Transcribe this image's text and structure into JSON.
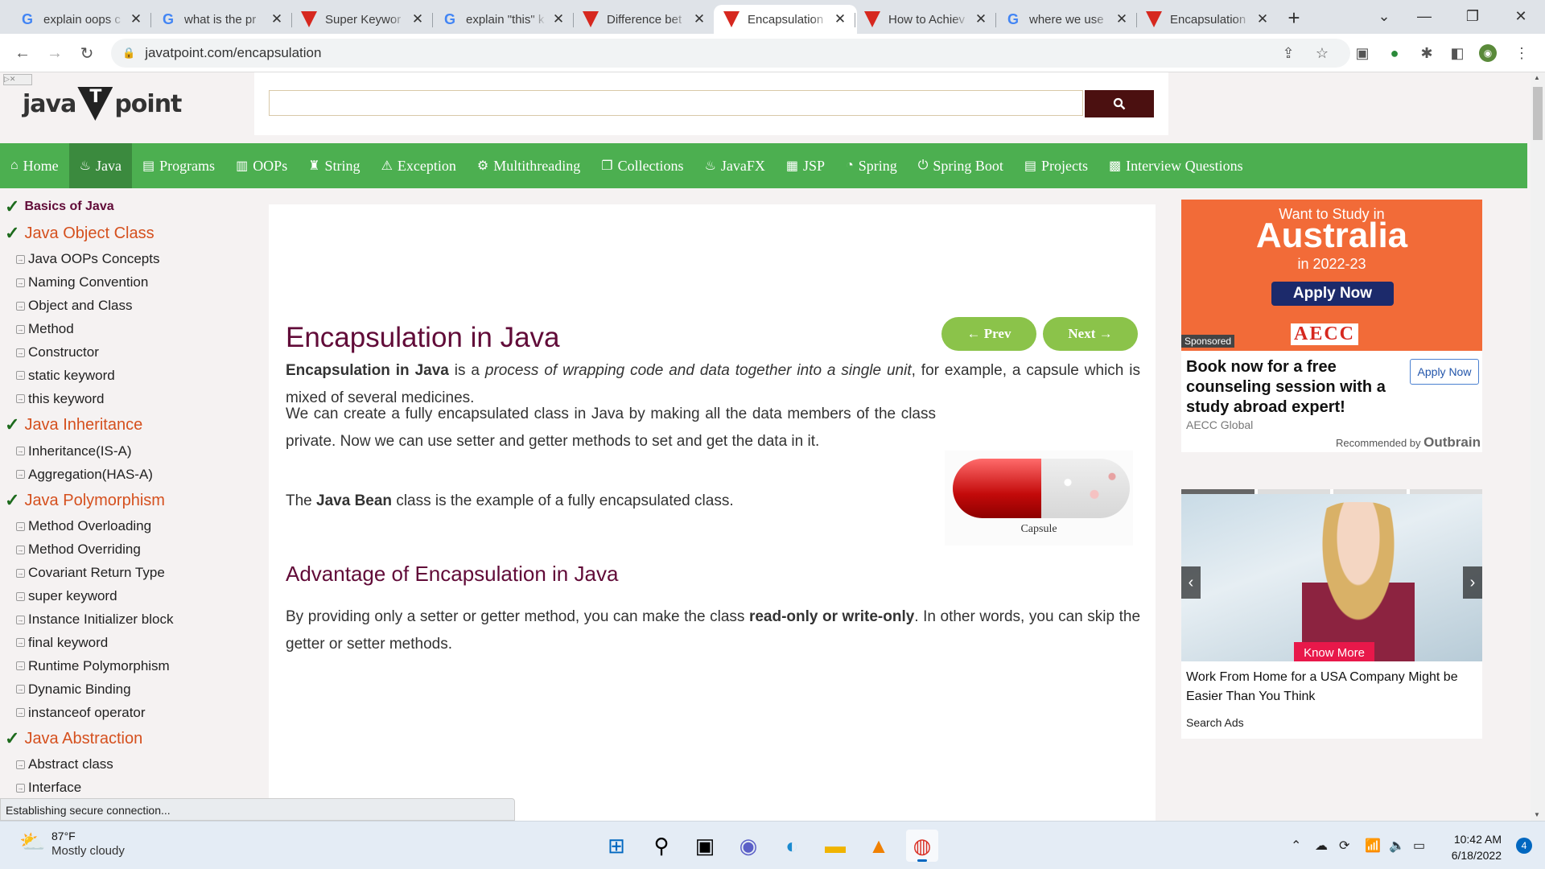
{
  "browser": {
    "tabs": [
      {
        "title": "explain oops c",
        "icon": "google-icon",
        "active": false
      },
      {
        "title": "what is the pr",
        "icon": "google-icon",
        "active": false
      },
      {
        "title": "Super Keywor",
        "icon": "javatpoint-icon",
        "active": false
      },
      {
        "title": "explain \"this\" k",
        "icon": "google-icon",
        "active": false
      },
      {
        "title": "Difference bet",
        "icon": "javatpoint-icon",
        "active": false
      },
      {
        "title": "Encapsulation",
        "icon": "javatpoint-icon",
        "active": true
      },
      {
        "title": "How to Achiev",
        "icon": "javatpoint-icon",
        "active": false
      },
      {
        "title": "where we use",
        "icon": "google-icon",
        "active": false
      },
      {
        "title": "Encapsulation",
        "icon": "javatpoint-icon",
        "active": false
      }
    ],
    "url": "javatpoint.com/encapsulation",
    "status_text": "Establishing secure connection..."
  },
  "site": {
    "logo_left": "java",
    "logo_mid": "T",
    "logo_right": "point",
    "search_placeholder": "",
    "nav": [
      {
        "label": "Home",
        "icon": "home-icon",
        "active": false
      },
      {
        "label": "Java",
        "icon": "java-icon",
        "active": true
      },
      {
        "label": "Programs",
        "icon": "programs-icon",
        "active": false
      },
      {
        "label": "OOPs",
        "icon": "oops-icon",
        "active": false
      },
      {
        "label": "String",
        "icon": "string-icon",
        "active": false
      },
      {
        "label": "Exception",
        "icon": "warning-icon",
        "active": false
      },
      {
        "label": "Multithreading",
        "icon": "thread-icon",
        "active": false
      },
      {
        "label": "Collections",
        "icon": "collections-icon",
        "active": false
      },
      {
        "label": "JavaFX",
        "icon": "javafx-icon",
        "active": false
      },
      {
        "label": "JSP",
        "icon": "jsp-icon",
        "active": false
      },
      {
        "label": "Spring",
        "icon": "spring-icon",
        "active": false
      },
      {
        "label": "Spring Boot",
        "icon": "power-icon",
        "active": false
      },
      {
        "label": "Projects",
        "icon": "projects-icon",
        "active": false
      },
      {
        "label": "Interview Questions",
        "icon": "interview-icon",
        "active": false
      }
    ]
  },
  "sidebar": {
    "basics": "Basics of Java",
    "sections": [
      {
        "title": "Java Object Class",
        "items": [
          "Java OOPs Concepts",
          "Naming Convention",
          "Object and Class",
          "Method",
          "Constructor",
          "static keyword",
          "this keyword"
        ]
      },
      {
        "title": "Java Inheritance",
        "items": [
          "Inheritance(IS-A)",
          "Aggregation(HAS-A)"
        ]
      },
      {
        "title": "Java Polymorphism",
        "items": [
          "Method Overloading",
          "Method Overriding",
          "Covariant Return Type",
          "super keyword",
          "Instance Initializer block",
          "final keyword",
          "Runtime Polymorphism",
          "Dynamic Binding",
          "instanceof operator"
        ]
      },
      {
        "title": "Java Abstraction",
        "items": [
          "Abstract class",
          "Interface"
        ]
      }
    ]
  },
  "article": {
    "title": "Encapsulation in Java",
    "prev": "← Prev",
    "next": "Next →",
    "p1_bold": "Encapsulation in Java",
    "p1_a": " is a ",
    "p1_italic": "process of wrapping code and data together into a single unit",
    "p1_b": ", for example, a capsule which is mixed of several medicines.",
    "p2": "We can create a fully encapsulated class in Java by making all the data members of the class private. Now we can use setter and getter methods to set and get the data in it.",
    "p3_a": "The ",
    "p3_bold": "Java Bean",
    "p3_b": " class is the example of a fully encapsulated class.",
    "capsule_label": "Capsule",
    "h2": "Advantage of Encapsulation in Java",
    "p4_a": "By providing only a setter or getter method, you can make the class ",
    "p4_bold": "read-only or write-only",
    "p4_b": ". In other words, you can skip the getter or setter methods."
  },
  "ads": {
    "ad1": {
      "want": "Want to Study in",
      "country": "Australia",
      "year": "in 2022-23",
      "apply": "Apply Now",
      "brand": "AECC",
      "sponsored": "Sponsored",
      "headline": "Book now for a free counseling session with a study abroad expert!",
      "cta": "Apply Now",
      "source": "AECC Global",
      "recommended": "Recommended by",
      "outbrain": "Outbrain"
    },
    "ad2": {
      "know_more": "Know More",
      "title": "Work From Home for a USA Company Might be Easier Than You Think",
      "source": "Search Ads"
    }
  },
  "taskbar": {
    "temp": "87°F",
    "weather": "Mostly cloudy",
    "time": "10:42 AM",
    "date": "6/18/2022",
    "notifications": "4"
  },
  "colors": {
    "nav_green": "#4caf50",
    "title_maroon": "#610b38",
    "sidebar_section": "#d5501e",
    "pill_green": "#8bc34a"
  }
}
